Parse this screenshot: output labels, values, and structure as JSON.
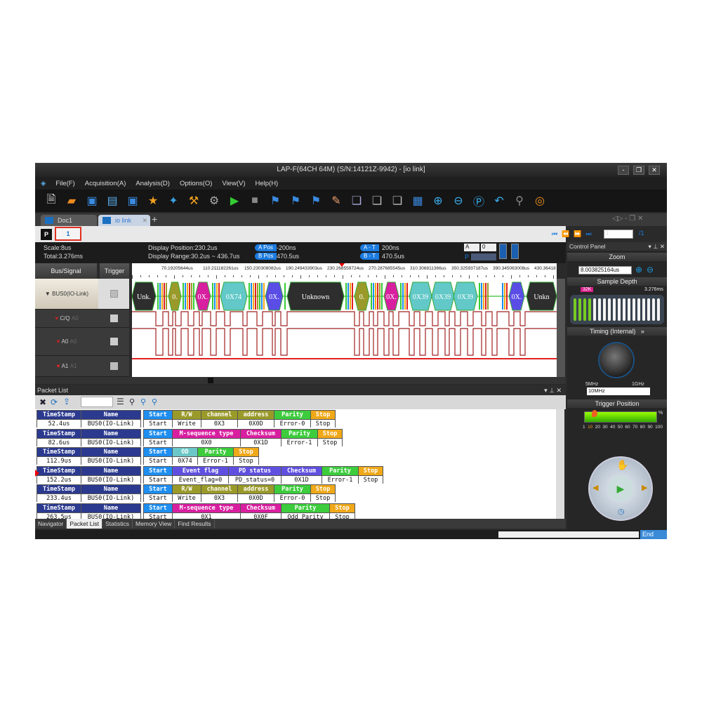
{
  "window": {
    "title": "LAP-F(64CH 64M) (S/N:14121Z-9942) - [io link]",
    "controls": [
      "-",
      "❐",
      "✕"
    ]
  },
  "menu": [
    "File(F)",
    "Acquisition(A)",
    "Analysis(D)",
    "Options(O)",
    "View(V)",
    "Help(H)"
  ],
  "toolbar_icons": [
    "new-file",
    "open-folder",
    "save",
    "print",
    "save-settings",
    "favorite-star",
    "wizard",
    "tools",
    "settings-gear",
    "run",
    "stop",
    "marker-add",
    "marker-remove",
    "marker-goto",
    "eraser",
    "copy-waveform",
    "paste-waveform",
    "export-waveform",
    "calculator",
    "zoom-in",
    "zoom-out",
    "zoom-fit",
    "zoom-undo",
    "probe",
    "help-lifebuoy"
  ],
  "tabs": [
    {
      "label": "Doc1"
    },
    {
      "label": "io link",
      "active": true
    }
  ],
  "pagebar": {
    "p_label": "P",
    "page_tab": "1",
    "page_input": "1",
    "page_total": "/1"
  },
  "info": {
    "scale": "Scale:8us",
    "total": "Total:3.276ms",
    "display_position": "Display Position:230.2us",
    "display_range": "Display Range:30.2us ~ 436.7us",
    "a_pos_label": "A Pos",
    "a_pos": "-200ns",
    "b_pos_label": "B Pos",
    "b_pos": "470.5us",
    "a_t_label": "A - T",
    "a_t": "200ns",
    "b_t_label": "B - T",
    "b_t": "470.5us",
    "sel1": "A",
    "sel2": "0",
    "p_label": "P"
  },
  "signals": {
    "header_bus": "Bus/Signal",
    "header_trigger": "Trigger",
    "rows": [
      {
        "name": "BUS0(IO-Link)"
      },
      {
        "name": "C/Q",
        "ch": "A0"
      },
      {
        "name": "A0",
        "ch": "A0"
      },
      {
        "name": "A1",
        "ch": "A1"
      }
    ]
  },
  "ruler": [
    "70.19205644us",
    "110.211182261us",
    "150.230308082us",
    "190.249433903us",
    "230.268559724us",
    "270.287685545us",
    "310.306811366us",
    "350.325937187us",
    "390.345063008us",
    "430.36418"
  ],
  "bus_segments": [
    {
      "label": "Unk.",
      "color": "#2e2e2e"
    },
    {
      "label": "0.",
      "color": "#9a9a2a"
    },
    {
      "label": "0X.",
      "color": "#d81fa0"
    },
    {
      "label": "0X74",
      "color": "#62c8c8"
    },
    {
      "label": "0X.",
      "color": "#5a4de6"
    },
    {
      "label": "Unknown",
      "color": "#2e2e2e"
    },
    {
      "label": "0.",
      "color": "#9a9a2a"
    },
    {
      "label": "0X.",
      "color": "#d81fa0"
    },
    {
      "label": "0X39",
      "color": "#62c8c8"
    },
    {
      "label": "0X39",
      "color": "#62c8c8"
    },
    {
      "label": "0X39",
      "color": "#62c8c8"
    },
    {
      "label": "0X.",
      "color": "#5a4de6"
    },
    {
      "label": "Unkn",
      "color": "#2e2e2e"
    }
  ],
  "packet_list": {
    "title": "Packet List",
    "rows": [
      [
        [
          "TimeStamp",
          "52.4us",
          "#2b3a8f"
        ],
        [
          "Name",
          "BUS0(IO-Link)",
          "#2b3a8f"
        ],
        [
          "Start",
          "Start",
          "#1e8ef0"
        ],
        [
          "R/W",
          "Write",
          "#9a9a2a"
        ],
        [
          "channel",
          "0X3",
          "#9a9a2a"
        ],
        [
          "address",
          "0X0D",
          "#9a9a2a"
        ],
        [
          "Parity",
          "Error-0",
          "#3ccc3c"
        ],
        [
          "Stop",
          "Stop",
          "#f0a818"
        ]
      ],
      [
        [
          "TimeStamp",
          "82.6us",
          "#2b3a8f"
        ],
        [
          "Name",
          "BUS0(IO-Link)",
          "#2b3a8f"
        ],
        [
          "Start",
          "Start",
          "#1e8ef0"
        ],
        [
          "M-sequence type",
          "0X0",
          "#d81fa0"
        ],
        [
          "Checksum",
          "0X1D",
          "#d81fa0"
        ],
        [
          "Parity",
          "Error-1",
          "#3ccc3c"
        ],
        [
          "Stop",
          "Stop",
          "#f0a818"
        ]
      ],
      [
        [
          "TimeStamp",
          "112.9us",
          "#2b3a8f"
        ],
        [
          "Name",
          "BUS0(IO-Link)",
          "#2b3a8f"
        ],
        [
          "Start",
          "Start",
          "#1e8ef0"
        ],
        [
          "OD",
          "0X74",
          "#6cc8c8"
        ],
        [
          "Parity",
          "Error-1",
          "#3ccc3c"
        ],
        [
          "Stop",
          "Stop",
          "#f0a818"
        ]
      ],
      [
        [
          "TimeStamp",
          "152.2us",
          "#2b3a8f"
        ],
        [
          "Name",
          "BUS0(IO-Link)",
          "#2b3a8f"
        ],
        [
          "Start",
          "Start",
          "#1e8ef0"
        ],
        [
          "Event flag",
          "Event_flag=0",
          "#6050e0"
        ],
        [
          "PD status",
          "PD_status=0",
          "#6050e0"
        ],
        [
          "Checksum",
          "0X1D",
          "#6050e0"
        ],
        [
          "Parity",
          "Error-1",
          "#3ccc3c"
        ],
        [
          "Stop",
          "Stop",
          "#f0a818"
        ]
      ],
      [
        [
          "TimeStamp",
          "233.4us",
          "#2b3a8f"
        ],
        [
          "Name",
          "BUS0(IO-Link)",
          "#2b3a8f"
        ],
        [
          "Start",
          "Start",
          "#1e8ef0"
        ],
        [
          "R/W",
          "Write",
          "#9a9a2a"
        ],
        [
          "channel",
          "0X3",
          "#9a9a2a"
        ],
        [
          "address",
          "0X0D",
          "#9a9a2a"
        ],
        [
          "Parity",
          "Error-0",
          "#3ccc3c"
        ],
        [
          "Stop",
          "Stop",
          "#f0a818"
        ]
      ],
      [
        [
          "TimeStamp",
          "263.5us",
          "#2b3a8f"
        ],
        [
          "Name",
          "BUS0(IO-Link)",
          "#2b3a8f"
        ],
        [
          "Start",
          "Start",
          "#1e8ef0"
        ],
        [
          "M-sequence type",
          "0X1",
          "#d81fa0"
        ],
        [
          "Checksum",
          "0X0F",
          "#d81fa0"
        ],
        [
          "Parity",
          "Odd Parity",
          "#3ccc3c"
        ],
        [
          "Stop",
          "Stop",
          "#f0a818"
        ]
      ]
    ]
  },
  "bottom_tabs": [
    {
      "label": "Navigator"
    },
    {
      "label": "Packet List",
      "active": true
    },
    {
      "label": "Statistics"
    },
    {
      "label": "Memory View"
    },
    {
      "label": "Find Results"
    }
  ],
  "status": {
    "end": "End"
  },
  "control_panel": {
    "title": "Control Panel",
    "zoom_label": "Zoom",
    "zoom_value": "8.003825164us",
    "sample_depth_label": "Sample Depth",
    "sample_badge": "32K",
    "sample_time": "3.276ms",
    "sample_depth_level_bars": 4,
    "sample_depth_total_bars": 18,
    "timing_label": "Timing (Internal)",
    "knob_min": "5MHz",
    "knob_max": "1GHz",
    "rate": "10MHz",
    "trigger_label": "Trigger Position",
    "trigger_pct": "%",
    "trigger_value": 10,
    "trigger_ticks": [
      "1",
      "10",
      "20",
      "30",
      "40",
      "50",
      "60",
      "70",
      "80",
      "90",
      "100"
    ]
  }
}
